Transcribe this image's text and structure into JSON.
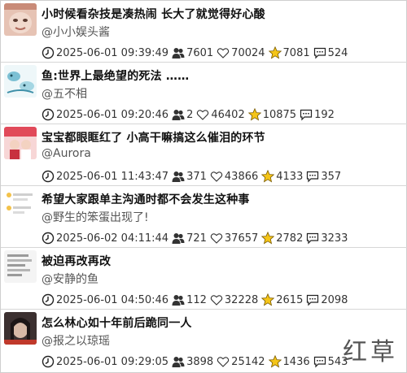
{
  "items": [
    {
      "title": "小时候看杂技是凑热闹 长大了就觉得好心酸",
      "author": "@小小娱头酱",
      "time": "2025-06-01 09:39:49",
      "fans": "7601",
      "likes": "70024",
      "stars": "7081",
      "comments": "524",
      "thumb_colors": [
        "#e8c6b8",
        "#c98b78"
      ]
    },
    {
      "title": "鱼:世界上最绝望的死法 ……",
      "author": "@五不相",
      "time": "2025-06-01 09:20:46",
      "fans": "2",
      "likes": "46402",
      "stars": "10875",
      "comments": "192",
      "thumb_colors": [
        "#dff0f4",
        "#6fb3c9"
      ]
    },
    {
      "title": "宝宝都眼眶红了 小高干嘛搞这么催泪的环节",
      "author": "@Aurora",
      "time": "2025-06-01 11:43:47",
      "fans": "371",
      "likes": "43866",
      "stars": "4133",
      "comments": "357",
      "thumb_colors": [
        "#e14a5a",
        "#f7d5d5"
      ]
    },
    {
      "title": "希望大家跟单主沟通时都不会发生这种事",
      "author": "@野生的笨蛋出现了!",
      "time": "2025-06-02 04:11:44",
      "fans": "721",
      "likes": "37657",
      "stars": "2782",
      "comments": "3233",
      "thumb_colors": [
        "#ffffff",
        "#f3c24a"
      ]
    },
    {
      "title": "被迫再改再改",
      "author": "@安静的鱼",
      "time": "2025-06-01 04:50:46",
      "fans": "112",
      "likes": "32228",
      "stars": "2615",
      "comments": "2098",
      "thumb_colors": [
        "#f4f4f4",
        "#9a9a9a"
      ]
    },
    {
      "title": "怎么林心如十年前后跪同一人",
      "author": "@报之以琼瑶",
      "time": "2025-06-01 09:29:05",
      "fans": "3898",
      "likes": "25142",
      "stars": "1436",
      "comments": "543",
      "thumb_colors": [
        "#3b3030",
        "#d7b9a6"
      ]
    }
  ],
  "watermark": "红草"
}
